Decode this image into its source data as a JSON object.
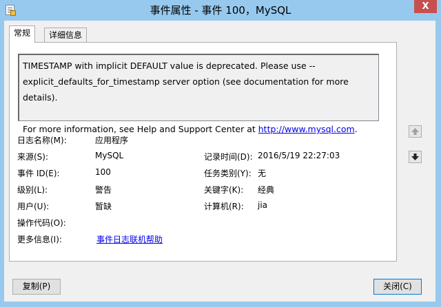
{
  "window": {
    "title": "事件属性 - 事件 100，MySQL",
    "close_glyph": "X"
  },
  "tabs": [
    {
      "label": "常规"
    },
    {
      "label": "详细信息"
    }
  ],
  "description": {
    "line1": "TIMESTAMP with implicit DEFAULT value is deprecated. Please use --",
    "line2": "explicit_defaults_for_timestamp server option (see documentation for more details).",
    "line3_prefix": "For more information, see Help and Support Center at ",
    "link": "http://www.mysql.com",
    "line3_suffix": "."
  },
  "fields": {
    "log_name_label": "日志名称(M):",
    "log_name": "应用程序",
    "source_label": "来源(S):",
    "source": "MySQL",
    "logged_label": "记录时间(D):",
    "logged": "2016/5/19 22:27:03",
    "event_id_label": "事件 ID(E):",
    "event_id": "100",
    "task_label": "任务类别(Y):",
    "task": "无",
    "level_label": "级别(L):",
    "level": "警告",
    "keywords_label": "关键字(K):",
    "keywords": "经典",
    "user_label": "用户(U):",
    "user": "暂缺",
    "computer_label": "计算机(R):",
    "computer": "jia",
    "opcode_label": "操作代码(O):",
    "opcode": "",
    "more_info_label": "更多信息(I):",
    "more_info_link": "事件日志联机帮助"
  },
  "buttons": {
    "copy": "复制(P)",
    "close": "关闭(C)"
  }
}
